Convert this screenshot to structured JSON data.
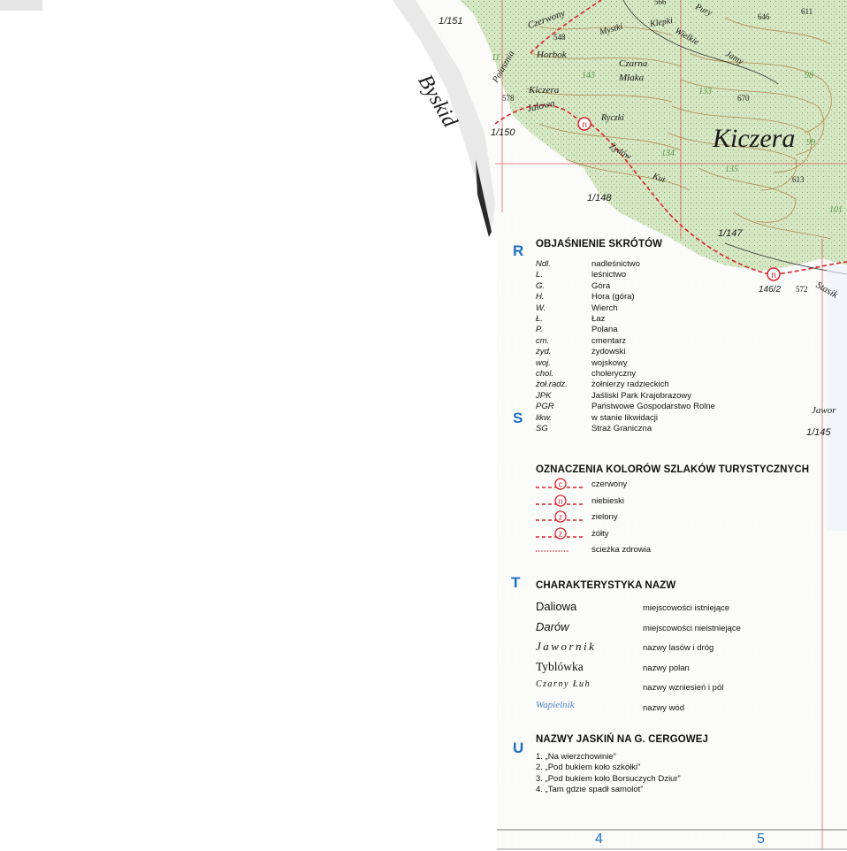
{
  "map": {
    "region_label": "Byskid",
    "place_labels": [
      "Czerwony",
      "Horbok",
      "Kiczera",
      "Jałowa",
      "Mystki",
      "Czarna",
      "Młaka",
      "Ryczki",
      "Żydów",
      "Kut",
      "Klepki",
      "Wielkie",
      "Pury",
      "Jamy",
      "Kiczera",
      "Stasik",
      "Jawor",
      "Poiasznia"
    ],
    "sheet_labels": [
      "1/151",
      "1/150",
      "1/148",
      "1/147",
      "146/2",
      "1/145"
    ],
    "elevations": [
      "548",
      "578",
      "566",
      "646",
      "611",
      "670",
      "613",
      "572"
    ],
    "forest_units": [
      "143",
      "133",
      "134",
      "135",
      "98",
      "99",
      "101",
      "11"
    ],
    "trail_colors": {
      "red": "#d6252a",
      "green_forest": "#cfe4bf",
      "brown_contour": "#b07b3a"
    }
  },
  "legend": {
    "abbr": {
      "letter": "R",
      "title": "OBJAŚNIENIE SKRÓTÓW",
      "items": [
        {
          "k": "Ndl.",
          "v": "nadleśnictwo"
        },
        {
          "k": "L.",
          "v": "leśnictwo"
        },
        {
          "k": "G.",
          "v": "Góra"
        },
        {
          "k": "H.",
          "v": "Hora (góra)"
        },
        {
          "k": "W.",
          "v": "Wierch"
        },
        {
          "k": "Ł.",
          "v": "Łaz"
        },
        {
          "k": "P.",
          "v": "Polana"
        },
        {
          "k": "cm.",
          "v": "cmentarz"
        },
        {
          "k": "żyd.",
          "v": "żydowski"
        },
        {
          "k": "woj.",
          "v": "wojskowy"
        },
        {
          "k": "chol.",
          "v": "choleryczny"
        },
        {
          "k": "żoł.radz.",
          "v": "żołnierzy radzieckich"
        },
        {
          "k": "JPK",
          "v": "Jaśliski Park Krajobrazowy"
        },
        {
          "k": "PGR",
          "v": "Państwowe Gospodarstwo Rolne"
        },
        {
          "k": "likw.",
          "v": "w stanie likwidacji"
        },
        {
          "k": "SG",
          "v": "Straż Graniczna"
        }
      ]
    },
    "trails": {
      "letter": "S",
      "title": "OZNACZENIA KOLORÓW SZLAKÓW TURYSTYCZNYCH",
      "items": [
        {
          "symbol": "c",
          "label": "czerwony"
        },
        {
          "symbol": "n",
          "label": "niebieski"
        },
        {
          "symbol": "z",
          "label": "zielony"
        },
        {
          "symbol": "ż",
          "label": "żółty"
        },
        {
          "symbol": "",
          "label": "ścieżka zdrowia"
        }
      ]
    },
    "names": {
      "letter": "T",
      "title": "CHARAKTERYSTYKA NAZW",
      "items": [
        {
          "ex": "Daliowa",
          "desc": "miejscowości istniejące"
        },
        {
          "ex": "Darów",
          "desc": "miejscowości nieistniejące"
        },
        {
          "ex": "Jawornik",
          "desc": "nazwy lasów i dróg"
        },
        {
          "ex": "Tyblówka",
          "desc": "nazwy polan"
        },
        {
          "ex": "Czarny Łuh",
          "desc": "nazwy wzniesień i pól"
        },
        {
          "ex": "Wapielnik",
          "desc": "nazwy wód"
        }
      ]
    },
    "caves": {
      "letter": "U",
      "title": "NAZWY JASKIŃ NA G. CERGOWEJ",
      "items": [
        "1. „Na wierzchowinie”",
        "2. „Pod bukiem koło szkółki”",
        "3. „Pod bukiem koło Borsuczych Dziur”",
        "4. „Tam gdzie spadł samolot”"
      ]
    }
  },
  "pages": {
    "left": "4",
    "right": "5"
  }
}
